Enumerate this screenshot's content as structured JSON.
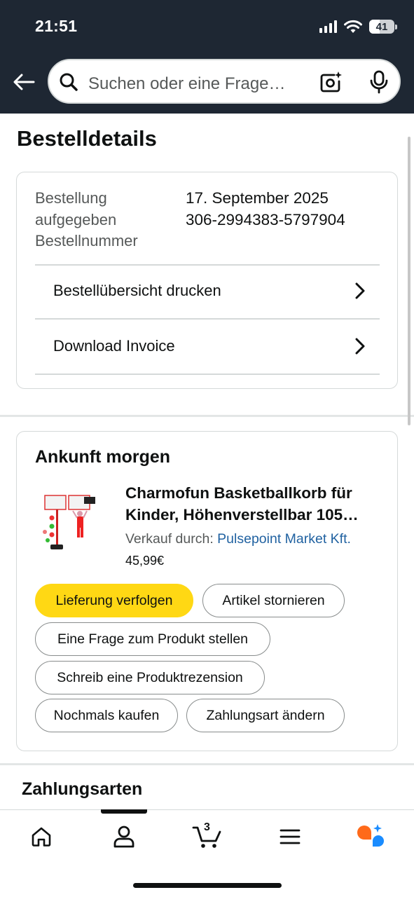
{
  "status_bar": {
    "time": "21:51",
    "battery": "41",
    "battery_level": 0.41
  },
  "search": {
    "placeholder": "Suchen oder eine Frage…"
  },
  "page": {
    "title": "Bestelldetails"
  },
  "order": {
    "label_lines": [
      "Bestellung",
      "aufgegeben",
      "Bestellnummer"
    ],
    "date": "17. September 2025",
    "number": "306-2994383-5797904",
    "actions": [
      {
        "label": "Bestellübersicht drucken"
      },
      {
        "label": "Download Invoice"
      }
    ]
  },
  "delivery": {
    "title": "Ankunft morgen",
    "product": {
      "title_line1": "Charmofun Basketballkorb für",
      "title_line2": "Kinder, Höhenverstellbar 105…",
      "seller_prefix": "Verkauf durch: ",
      "seller_name": "Pulsepoint Market Kft.",
      "price": "45,99€"
    },
    "buttons": {
      "track": "Lieferung verfolgen",
      "cancel": "Artikel stornieren",
      "ask": "Eine Frage zum Produkt stellen",
      "review": "Schreib eine Produktrezension",
      "buy_again": "Nochmals kaufen",
      "change_payment": "Zahlungsart ändern"
    }
  },
  "payments": {
    "title": "Zahlungsarten"
  },
  "bottom_nav": {
    "cart_count": "3",
    "items": [
      "home-icon",
      "account-icon",
      "cart-icon",
      "menu-icon",
      "rufus-icon"
    ],
    "active": "account-icon"
  },
  "colors": {
    "header_bg": "#1e2733",
    "primary_button": "#ffd814",
    "link": "#2162a1",
    "assistant_orange": "#ff6a1a",
    "assistant_blue": "#1a8cff"
  }
}
